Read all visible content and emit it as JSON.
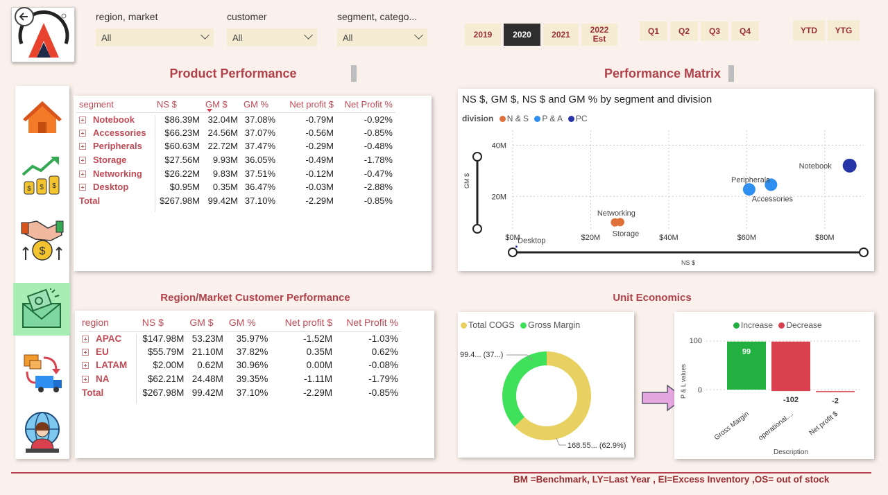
{
  "slicers": [
    {
      "label": "region, market",
      "value": "All"
    },
    {
      "label": "customer",
      "value": "All"
    },
    {
      "label": "segment, catego...",
      "value": "All"
    }
  ],
  "years": [
    {
      "label": "2019",
      "sub": "",
      "selected": false
    },
    {
      "label": "2020",
      "sub": "",
      "selected": true
    },
    {
      "label": "2021",
      "sub": "",
      "selected": false
    },
    {
      "label": "2022",
      "sub": "Est",
      "selected": false
    }
  ],
  "quarters": [
    "Q1",
    "Q2",
    "Q3",
    "Q4"
  ],
  "periods": [
    "YTD",
    "YTG"
  ],
  "product_performance": {
    "title": "Product Performance",
    "columns": [
      "segment",
      "NS $",
      "GM $",
      "GM %",
      "Net profit $",
      "Net Profit %"
    ],
    "rows": [
      {
        "name": "Notebook",
        "ns": "$86.39M",
        "gm": "32.04M",
        "gmp": "37.08%",
        "np": "-0.79M",
        "npp": "-0.92%"
      },
      {
        "name": "Accessories",
        "ns": "$66.23M",
        "gm": "24.56M",
        "gmp": "37.07%",
        "np": "-0.56M",
        "npp": "-0.85%"
      },
      {
        "name": "Peripherals",
        "ns": "$60.63M",
        "gm": "22.72M",
        "gmp": "37.47%",
        "np": "-0.29M",
        "npp": "-0.48%"
      },
      {
        "name": "Storage",
        "ns": "$27.56M",
        "gm": "9.93M",
        "gmp": "36.05%",
        "np": "-0.49M",
        "npp": "-1.78%"
      },
      {
        "name": "Networking",
        "ns": "$26.22M",
        "gm": "9.83M",
        "gmp": "37.51%",
        "np": "-0.12M",
        "npp": "-0.47%"
      },
      {
        "name": "Desktop",
        "ns": "$0.95M",
        "gm": "0.35M",
        "gmp": "36.47%",
        "np": "-0.03M",
        "npp": "-2.88%"
      }
    ],
    "total": {
      "name": "Total",
      "ns": "$267.98M",
      "gm": "99.42M",
      "gmp": "37.10%",
      "np": "-2.29M",
      "npp": "-0.85%"
    }
  },
  "performance_matrix": {
    "title": "Performance Matrix",
    "chart_title": "NS $, GM $, NS $ and GM % by segment and division",
    "legend_title": "division",
    "xlabel": "NS $",
    "ylabel": "GM $",
    "x_ticks": [
      "$0M",
      "$20M",
      "$40M",
      "$60M",
      "$80M"
    ],
    "y_ticks": [
      "20M",
      "40M"
    ]
  },
  "region_performance": {
    "title": "Region/Market Customer Performance",
    "columns": [
      "region",
      "NS $",
      "GM $",
      "GM %",
      "Net profit $",
      "Net Profit %"
    ],
    "rows": [
      {
        "name": "APAC",
        "ns": "$147.98M",
        "gm": "53.23M",
        "gmp": "35.97%",
        "np": "-1.52M",
        "npp": "-1.03%"
      },
      {
        "name": "EU",
        "ns": "$55.79M",
        "gm": "21.10M",
        "gmp": "37.82%",
        "np": "0.35M",
        "npp": "0.62%"
      },
      {
        "name": "LATAM",
        "ns": "$2.00M",
        "gm": "0.62M",
        "gmp": "30.96%",
        "np": "0.00M",
        "npp": "-0.08%"
      },
      {
        "name": "NA",
        "ns": "$62.21M",
        "gm": "24.48M",
        "gmp": "39.35%",
        "np": "-1.11M",
        "npp": "-1.79%"
      }
    ],
    "total": {
      "name": "Total",
      "ns": "$267.98M",
      "gm": "99.42M",
      "gmp": "37.10%",
      "np": "-2.29M",
      "npp": "-0.85%"
    }
  },
  "unit_economics": {
    "title": "Unit Economics",
    "donut_labels": [
      "99.4... (37...)",
      "168.55... (62.9%)"
    ],
    "waterfall_ylabel": "P & L values",
    "waterfall_xlabel": "Description",
    "waterfall_ticks": [
      "100",
      "0"
    ],
    "waterfall_bar_labels": [
      "99",
      "-102",
      "-2"
    ]
  },
  "footer": "BM =Benchmark,   LY=Last Year , EI=Excess Inventory ,OS= out of stock",
  "colors": {
    "accent": "#b0404a",
    "slicer_bg": "#f6ecd4",
    "selected_btn": "#2e2e2e",
    "n_s": "#e0703a",
    "p_a": "#2f8ff0",
    "pc": "#2634a8",
    "cogs": "#e8d160",
    "gross_margin": "#3fe05a",
    "increase": "#22b040",
    "decrease": "#d8414d",
    "arrow": "#e6a6e0"
  },
  "chart_data": [
    {
      "type": "scatter",
      "legend": {
        "title": "division",
        "placement": "top-left",
        "items": [
          {
            "name": "N & S",
            "color": "#e0703a"
          },
          {
            "name": "P & A",
            "color": "#2f8ff0"
          },
          {
            "name": "PC",
            "color": "#2634a8"
          }
        ]
      },
      "xlabel": "NS $",
      "ylabel": "GM $",
      "xlim": [
        0,
        90
      ],
      "ylim": [
        0,
        48
      ],
      "grid": true,
      "points": [
        {
          "label": "Notebook",
          "x": 86.39,
          "y": 32.04,
          "series": "PC"
        },
        {
          "label": "Accessories",
          "x": 66.23,
          "y": 24.56,
          "series": "P & A"
        },
        {
          "label": "Peripherals",
          "x": 60.63,
          "y": 22.72,
          "series": "P & A"
        },
        {
          "label": "Storage",
          "x": 27.56,
          "y": 9.93,
          "series": "N & S"
        },
        {
          "label": "Networking",
          "x": 26.22,
          "y": 9.83,
          "series": "N & S"
        },
        {
          "label": "Desktop",
          "x": 0.95,
          "y": 0.35,
          "series": "PC"
        }
      ]
    },
    {
      "type": "pie",
      "legend": {
        "placement": "top",
        "items": [
          {
            "name": "Total COGS",
            "color": "#e8d160"
          },
          {
            "name": "Gross Margin",
            "color": "#3fe05a"
          }
        ]
      },
      "slices": [
        {
          "name": "Total COGS",
          "value": 168.55,
          "percent": 62.9
        },
        {
          "name": "Gross Margin",
          "value": 99.4,
          "percent": 37.1
        }
      ]
    },
    {
      "type": "bar",
      "subtype": "waterfall",
      "legend": {
        "placement": "top",
        "items": [
          {
            "name": "Increase",
            "color": "#22b040"
          },
          {
            "name": "Decrease",
            "color": "#d8414d"
          }
        ]
      },
      "categories": [
        "Gross Margin",
        "operational....",
        "Net profit $"
      ],
      "values": [
        99,
        -102,
        -2
      ],
      "xlabel": "Description",
      "ylabel": "P & L values",
      "ylim": [
        -5,
        100
      ]
    }
  ]
}
